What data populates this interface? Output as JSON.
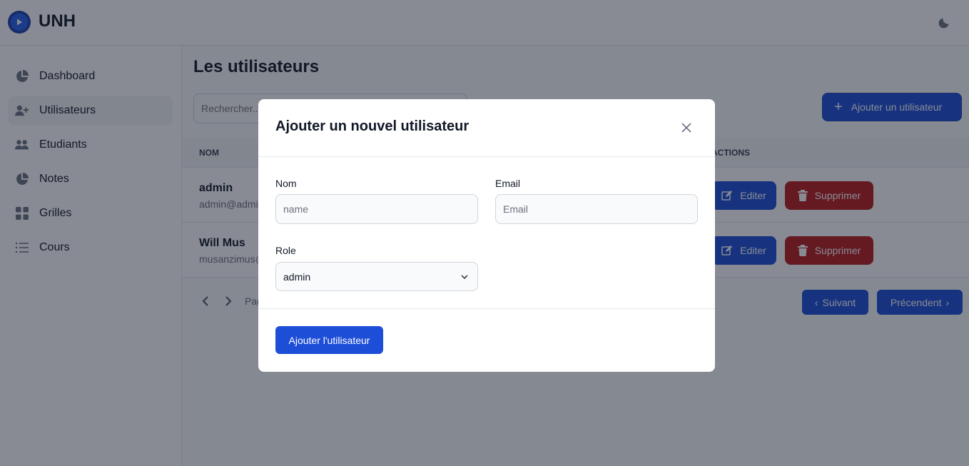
{
  "app": {
    "brand": "UNH"
  },
  "sidebar": {
    "items": [
      {
        "label": "Dashboard",
        "icon": "pie-chart-icon"
      },
      {
        "label": "Utilisateurs",
        "icon": "user-add-icon",
        "active": true
      },
      {
        "label": "Etudiants",
        "icon": "users-icon"
      },
      {
        "label": "Notes",
        "icon": "pie-chart-icon"
      },
      {
        "label": "Grilles",
        "icon": "grid-icon"
      },
      {
        "label": "Cours",
        "icon": "list-icon"
      }
    ]
  },
  "main": {
    "title": "Les utilisateurs",
    "search_placeholder": "Rechercher...",
    "add_button": "Ajouter un utilisateur",
    "table": {
      "headers": {
        "name": "NOM",
        "actions": "ACTIONS"
      },
      "rows": [
        {
          "name": "admin",
          "email": "admin@admin.com"
        },
        {
          "name": "Will Mus",
          "email": "musanzimus@gmail.com"
        }
      ],
      "edit_label": "Editer",
      "delete_label": "Supprimer"
    },
    "pager": {
      "text": "Page",
      "next_label": "Suivant",
      "prev_label": "Précendent"
    }
  },
  "modal": {
    "title": "Ajouter un nouvel utilisateur",
    "fields": {
      "name": {
        "label": "Nom",
        "placeholder": "name"
      },
      "email": {
        "label": "Email",
        "placeholder": "Email"
      },
      "role": {
        "label": "Role",
        "value": "admin"
      }
    },
    "submit_label": "Ajouter l'utilisateur"
  },
  "colors": {
    "primary": "#1d4ed8",
    "danger": "#b91c1c",
    "overlay": "rgba(17,24,39,0.5)"
  }
}
